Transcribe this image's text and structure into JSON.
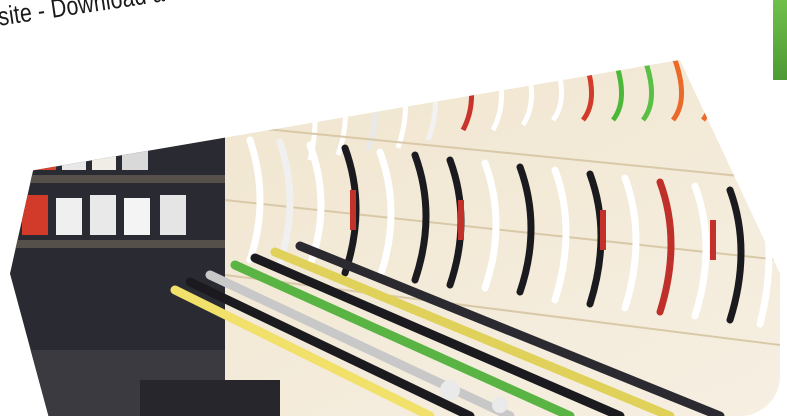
{
  "caption": {
    "text": "site - Download a free QR scanner app fr"
  },
  "colors": {
    "accent_green": "#5aae3c",
    "wall": "#f3ead8",
    "dark": "#1c1c22"
  },
  "photo": {
    "subject": "sports-store-wall"
  }
}
